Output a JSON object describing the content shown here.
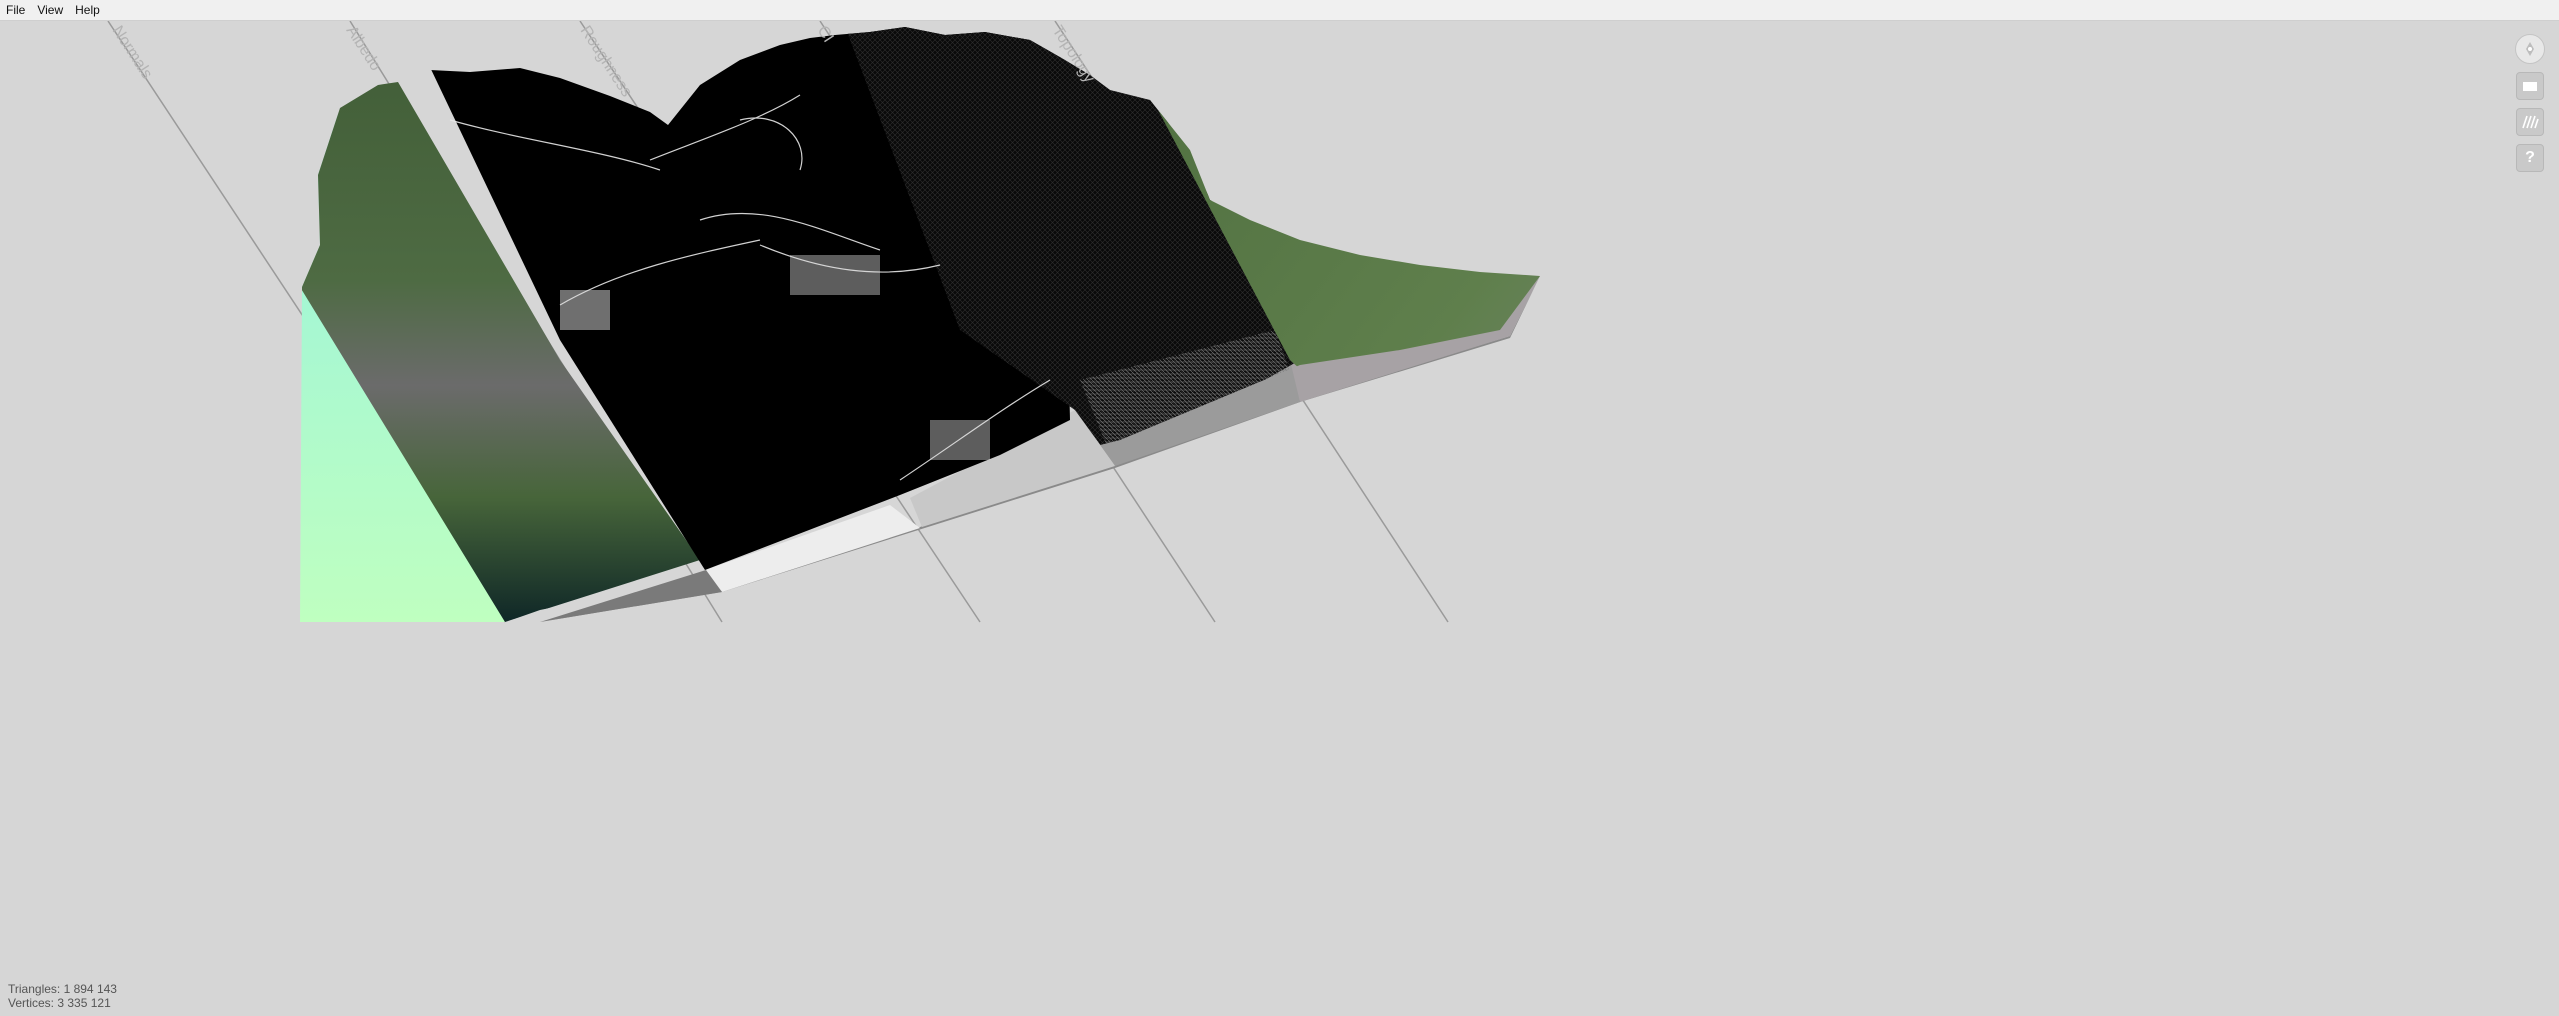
{
  "menu": {
    "file": "File",
    "view": "View",
    "help": "Help"
  },
  "slices": [
    {
      "label": "Normals"
    },
    {
      "label": "Albedo"
    },
    {
      "label": "Roughness"
    },
    {
      "label": "CI"
    },
    {
      "label": "Topology"
    }
  ],
  "toolbar": {
    "icons": [
      "compass-icon",
      "layer-icon",
      "stripes-icon",
      "help-icon"
    ],
    "help_glyph": "?"
  },
  "stats": {
    "triangles": "Triangles: 1 894 143",
    "vertices": "Vertices: 3 335 121"
  },
  "colors": {
    "background": "#d6d6d6",
    "normals": "#bfffc4",
    "terrain_green": "#4a6a3c",
    "black_pass": "#000000",
    "base_side": "#a7a2a5"
  }
}
